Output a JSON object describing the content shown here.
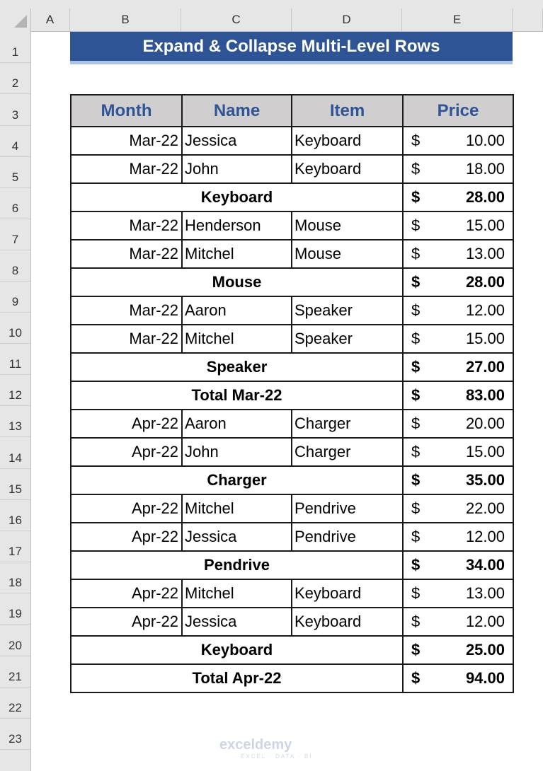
{
  "columns": [
    "A",
    "B",
    "C",
    "D",
    "E"
  ],
  "rows": [
    "1",
    "2",
    "3",
    "4",
    "5",
    "6",
    "7",
    "8",
    "9",
    "10",
    "11",
    "12",
    "13",
    "14",
    "15",
    "16",
    "17",
    "18",
    "19",
    "20",
    "21",
    "22",
    "23"
  ],
  "title": "Expand & Collapse Multi-Level Rows",
  "table": {
    "headers": [
      "Month",
      "Name",
      "Item",
      "Price"
    ],
    "currency": "$",
    "body": [
      {
        "type": "data",
        "month": "Mar-22",
        "name": "Jessica",
        "item": "Keyboard",
        "price": "10.00"
      },
      {
        "type": "data",
        "month": "Mar-22",
        "name": "John",
        "item": "Keyboard",
        "price": "18.00"
      },
      {
        "type": "sub",
        "label": "Keyboard",
        "price": "28.00"
      },
      {
        "type": "data",
        "month": "Mar-22",
        "name": "Henderson",
        "item": "Mouse",
        "price": "15.00"
      },
      {
        "type": "data",
        "month": "Mar-22",
        "name": "Mitchel",
        "item": "Mouse",
        "price": "13.00"
      },
      {
        "type": "sub",
        "label": "Mouse",
        "price": "28.00"
      },
      {
        "type": "data",
        "month": "Mar-22",
        "name": "Aaron",
        "item": "Speaker",
        "price": "12.00"
      },
      {
        "type": "data",
        "month": "Mar-22",
        "name": "Mitchel",
        "item": "Speaker",
        "price": "15.00"
      },
      {
        "type": "sub",
        "label": "Speaker",
        "price": "27.00"
      },
      {
        "type": "sub",
        "label": "Total Mar-22",
        "price": "83.00"
      },
      {
        "type": "data",
        "month": "Apr-22",
        "name": "Aaron",
        "item": "Charger",
        "price": "20.00"
      },
      {
        "type": "data",
        "month": "Apr-22",
        "name": "John",
        "item": "Charger",
        "price": "15.00"
      },
      {
        "type": "sub",
        "label": "Charger",
        "price": "35.00"
      },
      {
        "type": "data",
        "month": "Apr-22",
        "name": "Mitchel",
        "item": "Pendrive",
        "price": "22.00"
      },
      {
        "type": "data",
        "month": "Apr-22",
        "name": "Jessica",
        "item": "Pendrive",
        "price": "12.00"
      },
      {
        "type": "sub",
        "label": "Pendrive",
        "price": "34.00"
      },
      {
        "type": "data",
        "month": "Apr-22",
        "name": "Mitchel",
        "item": "Keyboard",
        "price": "13.00"
      },
      {
        "type": "data",
        "month": "Apr-22",
        "name": "Jessica",
        "item": "Keyboard",
        "price": "12.00"
      },
      {
        "type": "sub",
        "label": "Keyboard",
        "price": "25.00"
      },
      {
        "type": "sub",
        "label": "Total Apr-22",
        "price": "94.00"
      }
    ]
  },
  "watermark": {
    "brand": "exceldemy",
    "tagline": "EXCEL · DATA · BI"
  }
}
